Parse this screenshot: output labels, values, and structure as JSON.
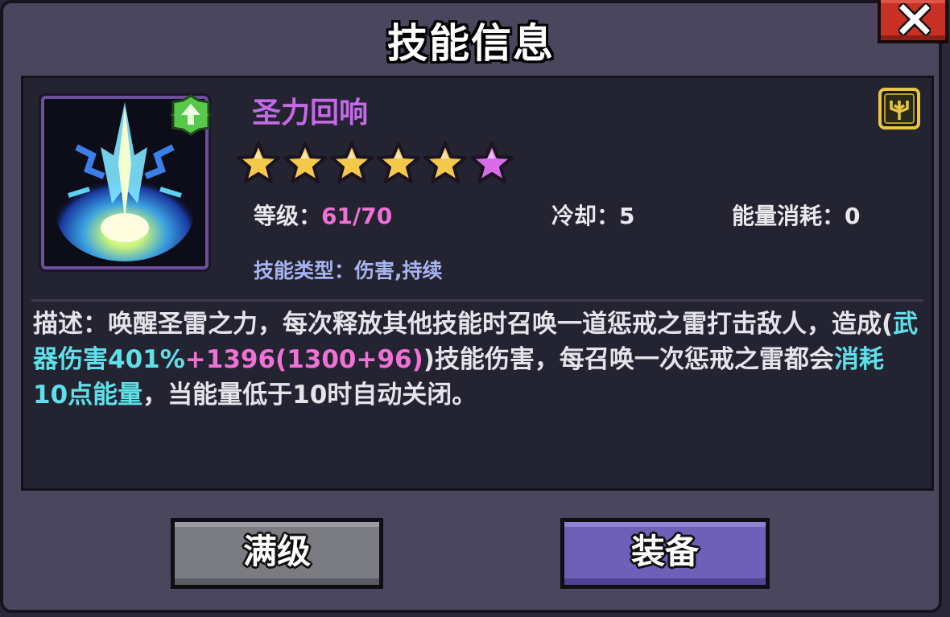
{
  "dialog": {
    "title": "技能信息",
    "close_icon": "close-x-icon"
  },
  "skill": {
    "name": "圣力回响",
    "art_icon": "holy-lightning-skill-icon",
    "badge_icon": "green-upgrade-badge-icon",
    "rune_icon": "gold-rune-icon",
    "stars": {
      "gold": 5,
      "purple": 1,
      "total": 6
    },
    "level_label": "等级：",
    "level_value": "61/70",
    "cooldown_label": "冷却：",
    "cooldown_value": "5",
    "energy_label": "能量消耗：",
    "energy_value": "0",
    "type_line": "技能类型：伤害,持续"
  },
  "description": {
    "seg1": "描述：唤醒圣雷之力，每次释放其他技能时召唤一道惩戒之雷打击敌人，造成(",
    "seg2": "武器伤害401%",
    "seg3": "+1396(1300+96)",
    "seg4": ")技能伤害，每召唤一次惩戒之雷都会",
    "seg5": "消耗10点能量",
    "seg6": "，当能量低于10时自动关闭。"
  },
  "buttons": {
    "max_level": "满级",
    "equip": "装备"
  },
  "colors": {
    "skill_name": "#c46ae6",
    "highlight_cyan": "#5fe0e9",
    "highlight_pink": "#f071d6",
    "star_gold": "#f4c84a",
    "star_purple": "#d96ae8"
  }
}
